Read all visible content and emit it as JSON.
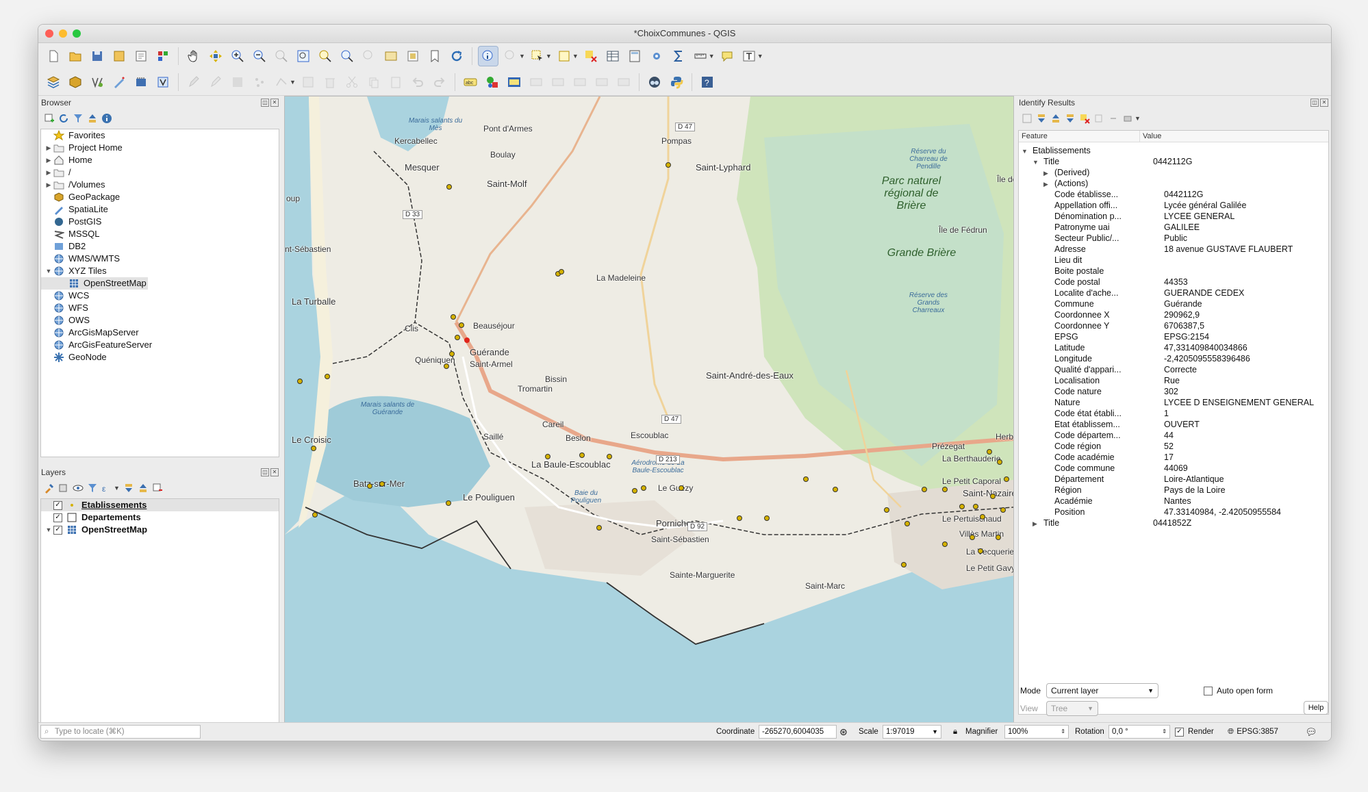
{
  "window": {
    "title": "*ChoixCommunes - QGIS"
  },
  "browser": {
    "title": "Browser",
    "items": [
      {
        "label": "Favorites",
        "icon": "star-icon",
        "arrow": ""
      },
      {
        "label": "Project Home",
        "icon": "folder-icon",
        "arrow": "▶"
      },
      {
        "label": "Home",
        "icon": "home-icon",
        "arrow": "▶"
      },
      {
        "label": "/",
        "icon": "folder-icon",
        "arrow": "▶"
      },
      {
        "label": "/Volumes",
        "icon": "folder-icon",
        "arrow": "▶"
      },
      {
        "label": "GeoPackage",
        "icon": "geopackage-icon",
        "arrow": ""
      },
      {
        "label": "SpatiaLite",
        "icon": "spatialite-icon",
        "arrow": ""
      },
      {
        "label": "PostGIS",
        "icon": "postgis-icon",
        "arrow": ""
      },
      {
        "label": "MSSQL",
        "icon": "mssql-icon",
        "arrow": ""
      },
      {
        "label": "DB2",
        "icon": "db2-icon",
        "arrow": ""
      },
      {
        "label": "WMS/WMTS",
        "icon": "globe-icon",
        "arrow": ""
      },
      {
        "label": "XYZ Tiles",
        "icon": "globe-icon",
        "arrow": "▼"
      },
      {
        "label": "OpenStreetMap",
        "icon": "grid-icon",
        "arrow": "",
        "child": true
      },
      {
        "label": "WCS",
        "icon": "globe-icon",
        "arrow": ""
      },
      {
        "label": "WFS",
        "icon": "globe-icon",
        "arrow": ""
      },
      {
        "label": "OWS",
        "icon": "globe-icon",
        "arrow": ""
      },
      {
        "label": "ArcGisMapServer",
        "icon": "globe-icon",
        "arrow": ""
      },
      {
        "label": "ArcGisFeatureServer",
        "icon": "globe-icon",
        "arrow": ""
      },
      {
        "label": "GeoNode",
        "icon": "geonode-icon",
        "arrow": ""
      }
    ]
  },
  "layers": {
    "title": "Layers",
    "items": [
      {
        "label": "Etablissements",
        "checked": true,
        "selected": true
      },
      {
        "label": "Departements",
        "checked": true,
        "selected": false
      },
      {
        "label": "OpenStreetMap",
        "checked": true,
        "selected": false
      }
    ]
  },
  "map": {
    "labels": [
      {
        "text": "Marais salants du Mès",
        "kind": "small"
      },
      {
        "text": "Pont d'Armes",
        "kind": ""
      },
      {
        "text": "Kercabellec",
        "kind": ""
      },
      {
        "text": "Pompas",
        "kind": ""
      },
      {
        "text": "Mesquer",
        "kind": "big"
      },
      {
        "text": "Boulay",
        "kind": ""
      },
      {
        "text": "Saint-Lyphard",
        "kind": "big"
      },
      {
        "text": "Saint-Molf",
        "kind": "big"
      },
      {
        "text": "Réserve du Charreau de Pendille",
        "kind": "small"
      },
      {
        "text": "Parc naturel régional de Brière",
        "kind": "park"
      },
      {
        "text": "Grande Brière",
        "kind": "park"
      },
      {
        "text": "Île de Fédrun",
        "kind": ""
      },
      {
        "text": "oup",
        "kind": ""
      },
      {
        "text": "nt-Sébastien",
        "kind": ""
      },
      {
        "text": "La Madeleine",
        "kind": ""
      },
      {
        "text": "Réserve des Grands Charreaux",
        "kind": "small"
      },
      {
        "text": "La Turballe",
        "kind": "big"
      },
      {
        "text": "Clis",
        "kind": ""
      },
      {
        "text": "Beauséjour",
        "kind": ""
      },
      {
        "text": "Guérande",
        "kind": "big"
      },
      {
        "text": "Quéniquen",
        "kind": ""
      },
      {
        "text": "Saint-Armel",
        "kind": ""
      },
      {
        "text": "Bissin",
        "kind": ""
      },
      {
        "text": "Saint-André-des-Eaux",
        "kind": "big"
      },
      {
        "text": "Tromartin",
        "kind": ""
      },
      {
        "text": "Marais salants de Guérande",
        "kind": "small"
      },
      {
        "text": "Careil",
        "kind": ""
      },
      {
        "text": "Le Croisic",
        "kind": "big"
      },
      {
        "text": "Saillé",
        "kind": ""
      },
      {
        "text": "Beslon",
        "kind": ""
      },
      {
        "text": "Escoublac",
        "kind": ""
      },
      {
        "text": "Herbi",
        "kind": ""
      },
      {
        "text": "Prézegat",
        "kind": ""
      },
      {
        "text": "La Berthauderie",
        "kind": ""
      },
      {
        "text": "La Baule-Escoublac",
        "kind": "big"
      },
      {
        "text": "Aérodrome de La Baule-Escoublac",
        "kind": "small"
      },
      {
        "text": "Le Petit Caporal",
        "kind": ""
      },
      {
        "text": "Batz-sur-Mer",
        "kind": "big"
      },
      {
        "text": "Le Guézy",
        "kind": ""
      },
      {
        "text": "Saint-Nazaire",
        "kind": "big"
      },
      {
        "text": "Le Pouliguen",
        "kind": "big"
      },
      {
        "text": "Baie du Pouliguen",
        "kind": "small"
      },
      {
        "text": "Le Pertuischaud",
        "kind": ""
      },
      {
        "text": "Pornichet",
        "kind": "big"
      },
      {
        "text": "Villès Martin",
        "kind": ""
      },
      {
        "text": "Saint-Sébastien",
        "kind": ""
      },
      {
        "text": "La Vecquerie",
        "kind": ""
      },
      {
        "text": "Le Petit Gavy",
        "kind": ""
      },
      {
        "text": "Sainte-Marguerite",
        "kind": ""
      },
      {
        "text": "Saint-Marc",
        "kind": ""
      },
      {
        "text": "Île de",
        "kind": ""
      }
    ],
    "roads": [
      "D 47",
      "D 33",
      "D 47",
      "D 213",
      "D 92"
    ]
  },
  "identify": {
    "title": "Identify Results",
    "col_feature": "Feature",
    "col_value": "Value",
    "rows": [
      {
        "indent": 0,
        "arrow": "▼",
        "f": "Etablissements",
        "v": ""
      },
      {
        "indent": 1,
        "arrow": "▼",
        "f": "Title",
        "v": "0442112G"
      },
      {
        "indent": 2,
        "arrow": "▶",
        "f": "(Derived)",
        "v": ""
      },
      {
        "indent": 2,
        "arrow": "▶",
        "f": "(Actions)",
        "v": ""
      },
      {
        "indent": 2,
        "arrow": "",
        "f": "Code établisse...",
        "v": "0442112G"
      },
      {
        "indent": 2,
        "arrow": "",
        "f": "Appellation offi...",
        "v": "Lycée général Galilée"
      },
      {
        "indent": 2,
        "arrow": "",
        "f": "Dénomination p...",
        "v": "LYCEE GENERAL"
      },
      {
        "indent": 2,
        "arrow": "",
        "f": "Patronyme uai",
        "v": "GALILEE"
      },
      {
        "indent": 2,
        "arrow": "",
        "f": "Secteur Public/...",
        "v": "Public"
      },
      {
        "indent": 2,
        "arrow": "",
        "f": "Adresse",
        "v": "18 avenue GUSTAVE FLAUBERT"
      },
      {
        "indent": 2,
        "arrow": "",
        "f": "Lieu dit",
        "v": ""
      },
      {
        "indent": 2,
        "arrow": "",
        "f": "Boite postale",
        "v": ""
      },
      {
        "indent": 2,
        "arrow": "",
        "f": "Code postal",
        "v": "44353"
      },
      {
        "indent": 2,
        "arrow": "",
        "f": "Localite d'ache...",
        "v": "GUERANDE CEDEX"
      },
      {
        "indent": 2,
        "arrow": "",
        "f": "Commune",
        "v": "Guérande"
      },
      {
        "indent": 2,
        "arrow": "",
        "f": "Coordonnee X",
        "v": "290962,9"
      },
      {
        "indent": 2,
        "arrow": "",
        "f": "Coordonnee Y",
        "v": "6706387,5"
      },
      {
        "indent": 2,
        "arrow": "",
        "f": "EPSG",
        "v": "EPSG:2154"
      },
      {
        "indent": 2,
        "arrow": "",
        "f": "Latitude",
        "v": "47,331409840034866"
      },
      {
        "indent": 2,
        "arrow": "",
        "f": "Longitude",
        "v": "-2,4205095558396486"
      },
      {
        "indent": 2,
        "arrow": "",
        "f": "Qualité d'appari...",
        "v": "Correcte"
      },
      {
        "indent": 2,
        "arrow": "",
        "f": "Localisation",
        "v": "Rue"
      },
      {
        "indent": 2,
        "arrow": "",
        "f": "Code nature",
        "v": "302"
      },
      {
        "indent": 2,
        "arrow": "",
        "f": "Nature",
        "v": "LYCEE D ENSEIGNEMENT GENERAL"
      },
      {
        "indent": 2,
        "arrow": "",
        "f": "Code état établi...",
        "v": "1"
      },
      {
        "indent": 2,
        "arrow": "",
        "f": "Etat établissem...",
        "v": "OUVERT"
      },
      {
        "indent": 2,
        "arrow": "",
        "f": "Code départem...",
        "v": "44"
      },
      {
        "indent": 2,
        "arrow": "",
        "f": "Code région",
        "v": "52"
      },
      {
        "indent": 2,
        "arrow": "",
        "f": "Code académie",
        "v": "17"
      },
      {
        "indent": 2,
        "arrow": "",
        "f": "Code commune",
        "v": "44069"
      },
      {
        "indent": 2,
        "arrow": "",
        "f": "Département",
        "v": "Loire-Atlantique"
      },
      {
        "indent": 2,
        "arrow": "",
        "f": "Région",
        "v": "Pays de la Loire"
      },
      {
        "indent": 2,
        "arrow": "",
        "f": "Académie",
        "v": "Nantes"
      },
      {
        "indent": 2,
        "arrow": "",
        "f": "Position",
        "v": "47.33140984, -2.42050955584"
      },
      {
        "indent": 1,
        "arrow": "▶",
        "f": "Title",
        "v": "0441852Z"
      }
    ],
    "mode_label": "Mode",
    "mode_value": "Current layer",
    "auto_open_label": "Auto open form",
    "view_label": "View",
    "view_value": "Tree",
    "help_label": "Help"
  },
  "status": {
    "locate_placeholder": "Type to locate (⌘K)",
    "coordinate_label": "Coordinate",
    "coordinate_value": "-265270,6004035",
    "scale_label": "Scale",
    "scale_value": "1:97019",
    "magnifier_label": "Magnifier",
    "magnifier_value": "100%",
    "rotation_label": "Rotation",
    "rotation_value": "0,0 °",
    "render_label": "Render",
    "crs_label": "EPSG:3857"
  },
  "colors": {
    "water": "#aad3df",
    "land": "#eeece4",
    "wetland": "#c7dfb0",
    "highway": "#e8a78a",
    "point": "#d4b100",
    "selected_point": "#e0241b",
    "boundary": "#333333"
  }
}
